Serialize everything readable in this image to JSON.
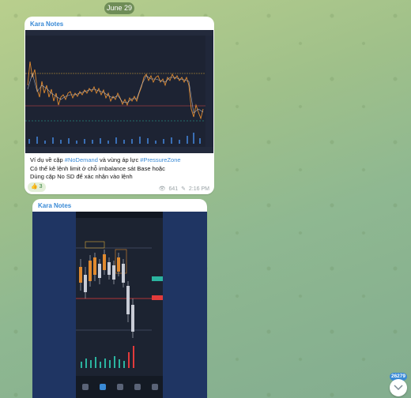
{
  "date_separator": "June 29",
  "messages": [
    {
      "author": "Kara Notes",
      "text_lines": [
        {
          "prefix": "Ví dụ về cặp ",
          "tag1": "#NoDemand",
          "middle": " và vùng áp lực ",
          "tag2": "#PressureZone"
        },
        "Có thể kê lệnh limit ở chỗ imbalance sát Base hoặc",
        "Dùng cặp No SD để xác nhận vào lệnh"
      ],
      "reaction": {
        "emoji": "👍",
        "count": "3"
      },
      "views": "641",
      "time": "2:16 PM"
    },
    {
      "author": "Kara Notes"
    }
  ],
  "unread_counter": "26279",
  "colors": {
    "accent": "#3a8ad6",
    "chart_bg": "#1d2333",
    "up_candle": "#e08a2f",
    "down_candle": "#c8ccd6",
    "level_red": "#e23b3b"
  }
}
